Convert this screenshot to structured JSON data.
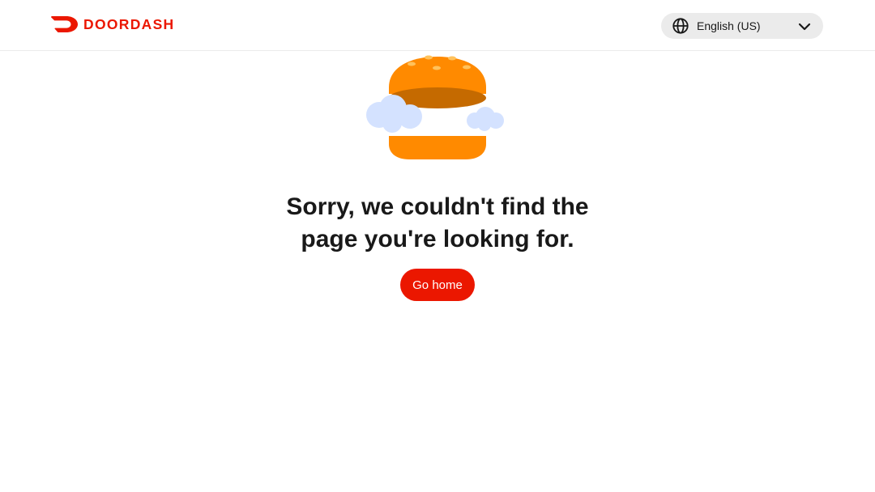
{
  "header": {
    "brand": "DOORDASH",
    "language_selector": {
      "selected": "English (US)"
    }
  },
  "main": {
    "message_line_1": "Sorry, we couldn't find the",
    "message_line_2": "page you're looking for.",
    "go_home_label": "Go home"
  },
  "icons": {
    "logo": "doordash-logo-icon",
    "globe": "globe-icon",
    "chevron": "chevron-down-icon",
    "illustration": "floating-burger-illustration"
  },
  "colors": {
    "brand_red": "#eb1700",
    "text": "#191919",
    "select_bg": "#ebebeb",
    "bun_top": "#ff8a00",
    "bun_shade": "#c56a00",
    "bun_bottom": "#ff8a00",
    "sesame": "#ffc25c",
    "cloud": "#d4e2ff"
  }
}
